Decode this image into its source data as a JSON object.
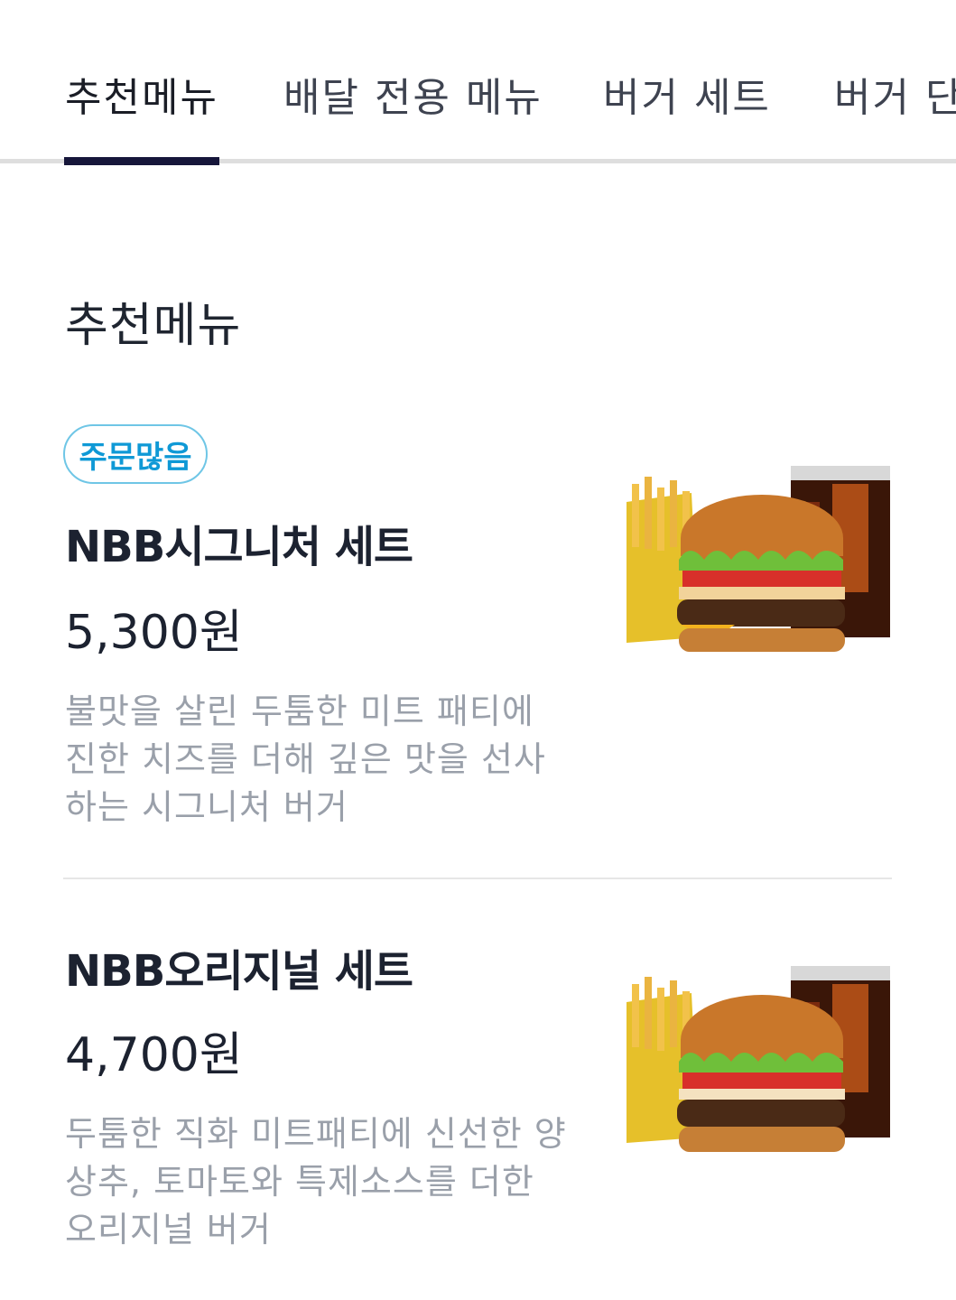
{
  "tabs": [
    {
      "label": "추천메뉴",
      "active": true
    },
    {
      "label": "배달 전용 메뉴",
      "active": false
    },
    {
      "label": "버거 세트",
      "active": false
    },
    {
      "label": "버거 단",
      "active": false
    }
  ],
  "section": {
    "title": "추천메뉴"
  },
  "items": [
    {
      "badge": "주문많음",
      "name": "NBB시그니처 세트",
      "price": "5,300원",
      "description": "불맛을 살린 두툼한 미트 패티에 진한 치즈를 더해 깊은 맛을 선사하는 시그니처 버거",
      "image": "burger-set-photo"
    },
    {
      "name": "NBB오리지널 세트",
      "price": "4,700원",
      "description": "두툼한 직화 미트패티에 신선한 양상추, 토마토와 특제소스를 더한 오리지널 버거",
      "image": "burger-set-photo"
    }
  ],
  "colors": {
    "accent_tab": "#16163a",
    "badge_text": "#0f99d6",
    "badge_border": "#6fc6e6",
    "desc_text": "#9aa0aa"
  }
}
